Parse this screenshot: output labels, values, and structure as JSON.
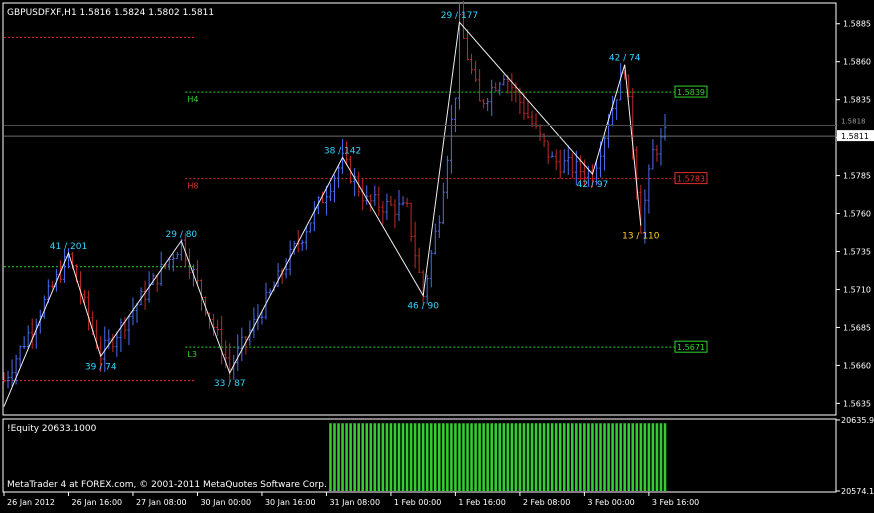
{
  "header": {
    "symbol_line": "GBPUSDFXF,H1  1.5816 1.5824 1.5802 1.5811"
  },
  "footer": {
    "copyright": "MetaTrader 4 at FOREX.com, © 2001-2011 MetaQuotes Software Corp."
  },
  "colors": {
    "background": "#000000",
    "axis": "#ffffff",
    "bull_bar": "#4a6cf0",
    "bear_bar": "#c62828",
    "zigzag": "#f0f0f0",
    "zigzag_label": "#33d6ff",
    "last_label": "#ffd21a",
    "level_green": "#2fd22f",
    "level_red": "#e53030",
    "equity_fill": "#1f7a1f",
    "equity_stroke": "#33cc33"
  },
  "chart_data": {
    "type": "bar",
    "symbol": "GBPUSDFXF",
    "timeframe": "H1",
    "ylim": [
      1.5628,
      1.5898
    ],
    "y_ticks": [
      "1.5885",
      "1.5860",
      "1.5835",
      "1.5810",
      "1.5785",
      "1.5760",
      "1.5735",
      "1.5710",
      "1.5685",
      "1.5660",
      "1.5635"
    ],
    "y_tick_values": [
      1.5885,
      1.586,
      1.5835,
      1.581,
      1.5785,
      1.576,
      1.5735,
      1.571,
      1.5685,
      1.566,
      1.5635
    ],
    "current_price": "1.5811",
    "current_price_value": 1.5811,
    "current_price_box": "1.5818",
    "current_price_box_value": 1.5818,
    "x_ticks": [
      "26 Jan 2012",
      "26 Jan 16:00",
      "27 Jan 08:00",
      "30 Jan 00:00",
      "30 Jan 16:00",
      "31 Jan 08:00",
      "1 Feb 00:00",
      "1 Feb 16:00",
      "2 Feb 08:00",
      "3 Feb 00:00",
      "3 Feb 16:00"
    ],
    "x_tick_index": [
      0,
      16,
      32,
      48,
      64,
      80,
      96,
      112,
      128,
      144,
      160
    ],
    "bars_count": 165,
    "bars_anchors": [
      {
        "i": 0,
        "p": 1.565
      },
      {
        "i": 16,
        "p": 1.5732
      },
      {
        "i": 24,
        "p": 1.5667
      },
      {
        "i": 44,
        "p": 1.5741
      },
      {
        "i": 56,
        "p": 1.5658
      },
      {
        "i": 84,
        "p": 1.5795
      },
      {
        "i": 90,
        "p": 1.5768
      },
      {
        "i": 100,
        "p": 1.5762
      },
      {
        "i": 104,
        "p": 1.5706
      },
      {
        "i": 108,
        "p": 1.576
      },
      {
        "i": 112,
        "p": 1.584
      },
      {
        "i": 113,
        "p": 1.5885
      },
      {
        "i": 118,
        "p": 1.5832
      },
      {
        "i": 124,
        "p": 1.5853
      },
      {
        "i": 136,
        "p": 1.5795
      },
      {
        "i": 146,
        "p": 1.5786
      },
      {
        "i": 154,
        "p": 1.5857
      },
      {
        "i": 156,
        "p": 1.5805
      },
      {
        "i": 158,
        "p": 1.5752
      },
      {
        "i": 161,
        "p": 1.58
      },
      {
        "i": 164,
        "p": 1.5811
      }
    ],
    "zigzag": [
      {
        "i": 0,
        "p": 1.5633,
        "label": ""
      },
      {
        "i": 16,
        "p": 1.5734,
        "label": "41 / 201"
      },
      {
        "i": 24,
        "p": 1.5666,
        "label": "39 / 74"
      },
      {
        "i": 44,
        "p": 1.5742,
        "label": "29 / 80"
      },
      {
        "i": 56,
        "p": 1.5655,
        "label": "33 / 87"
      },
      {
        "i": 84,
        "p": 1.5797,
        "label": "38 / 142"
      },
      {
        "i": 104,
        "p": 1.5706,
        "label": "46 / 90"
      },
      {
        "i": 113,
        "p": 1.5886,
        "label": "29 / 177"
      },
      {
        "i": 146,
        "p": 1.5786,
        "label": "42 / 97"
      },
      {
        "i": 154,
        "p": 1.5858,
        "label": "42 / 74"
      },
      {
        "i": 158,
        "p": 1.5752,
        "label": "13 / 110"
      }
    ],
    "levels": [
      {
        "name": "top-left-red",
        "price": 1.5876,
        "from_i": 0,
        "to_i": 45,
        "color": "red",
        "label": "",
        "box": ""
      },
      {
        "name": "H4",
        "price": 1.584,
        "from_i": 45,
        "to_i": 164,
        "color": "green",
        "label": "H4",
        "box": "1.5839"
      },
      {
        "name": "H8",
        "price": 1.5783,
        "from_i": 45,
        "to_i": 164,
        "color": "red",
        "label": "H8",
        "box": "1.5783"
      },
      {
        "name": "left-green",
        "price": 1.5725,
        "from_i": 0,
        "to_i": 45,
        "color": "green",
        "label": "",
        "box": ""
      },
      {
        "name": "L3",
        "price": 1.5672,
        "from_i": 45,
        "to_i": 164,
        "color": "green",
        "label": "L3",
        "box": "1.5671"
      },
      {
        "name": "left-red-low",
        "price": 1.565,
        "from_i": 0,
        "to_i": 45,
        "color": "red",
        "label": "",
        "box": ""
      }
    ],
    "indicator": {
      "label": "!Equity 20633.1000",
      "ylim": [
        20574.1,
        20635.9
      ],
      "y_ticks": [
        "20635.9",
        "20574.1"
      ],
      "y_tick_values": [
        20635.9,
        20574.1
      ],
      "value": 20633.1,
      "from_i": 81,
      "to_i": 164
    }
  }
}
